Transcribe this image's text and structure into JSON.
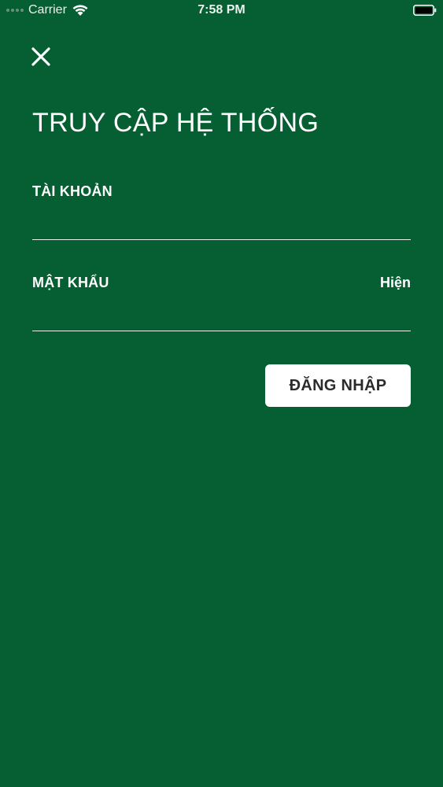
{
  "status_bar": {
    "carrier": "Carrier",
    "time": "7:58 PM",
    "wifi_icon": "wifi-icon",
    "battery_icon": "battery-icon"
  },
  "header": {
    "close_icon": "close-icon",
    "title": "TRUY CẬP HỆ THỐNG"
  },
  "form": {
    "username": {
      "label": "TÀI KHOẢN",
      "value": "",
      "placeholder": ""
    },
    "password": {
      "label": "MẬT KHẨU",
      "value": "",
      "placeholder": "",
      "toggle_label": "Hiện"
    },
    "submit_label": "ĐĂNG NHẬP"
  },
  "colors": {
    "background": "#065e33",
    "text": "#ffffff",
    "button_bg": "#ffffff",
    "button_text": "#2b2b2b"
  }
}
